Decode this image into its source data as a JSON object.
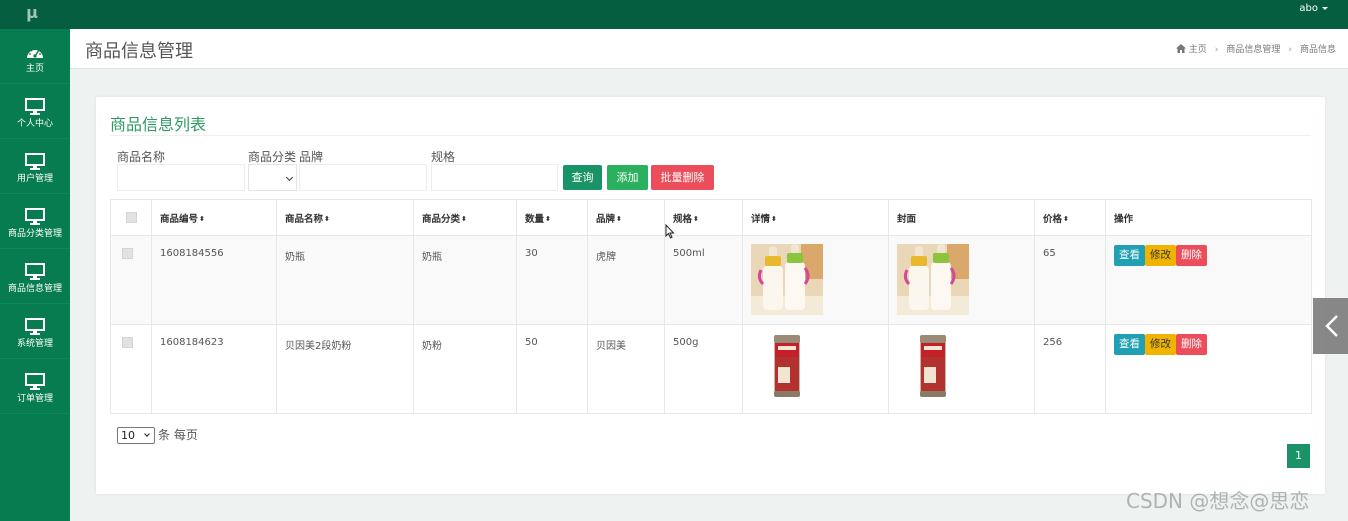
{
  "app": {
    "logo": "μ",
    "user": "abo"
  },
  "sidebar": {
    "items": [
      {
        "label": "主页",
        "icon": "dashboard-icon"
      },
      {
        "label": "个人中心",
        "icon": "monitor-icon"
      },
      {
        "label": "用户管理",
        "icon": "monitor-icon"
      },
      {
        "label": "商品分类管理",
        "icon": "monitor-icon"
      },
      {
        "label": "商品信息管理",
        "icon": "monitor-icon"
      },
      {
        "label": "系统管理",
        "icon": "monitor-icon"
      },
      {
        "label": "订单管理",
        "icon": "monitor-icon"
      }
    ]
  },
  "header": {
    "title": "商品信息管理",
    "breadcrumb": [
      "主页",
      "商品信息管理",
      "商品信息"
    ]
  },
  "panel": {
    "title": "商品信息列表"
  },
  "filters": {
    "name_label": "商品名称",
    "category_label": "商品分类",
    "brand_label": "品牌",
    "spec_label": "规格",
    "name_value": "",
    "category_value": "",
    "brand_value": "",
    "spec_value": ""
  },
  "toolbar": {
    "query": "查询",
    "add": "添加",
    "batch_delete": "批量删除"
  },
  "table": {
    "columns": [
      "商品编号",
      "商品名称",
      "商品分类",
      "数量",
      "品牌",
      "规格",
      "详情",
      "封面",
      "价格",
      "操作"
    ],
    "rows": [
      {
        "id": "1608184556",
        "name": "奶瓶",
        "category": "奶瓶",
        "qty": "30",
        "brand": "虎牌",
        "spec": "500ml",
        "price": "65",
        "image": "baby-bottles"
      },
      {
        "id": "1608184623",
        "name": "贝因美2段奶粉",
        "category": "奶粉",
        "qty": "50",
        "brand": "贝因美",
        "spec": "500g",
        "price": "256",
        "image": "milk-powder-can"
      }
    ],
    "row_actions": {
      "view": "查看",
      "edit": "修改",
      "delete": "删除"
    }
  },
  "pagination": {
    "page_size": "10",
    "page_size_suffix": "条 每页",
    "current_page": "1"
  },
  "watermark": "CSDN @想念@思恋",
  "colors": {
    "topbar": "#045e3f",
    "sidebar": "#067c50",
    "accent": "#1a9466",
    "add": "#2bb05f",
    "danger": "#ec4d5a",
    "info": "#20a0b2",
    "warning": "#f0b400"
  }
}
